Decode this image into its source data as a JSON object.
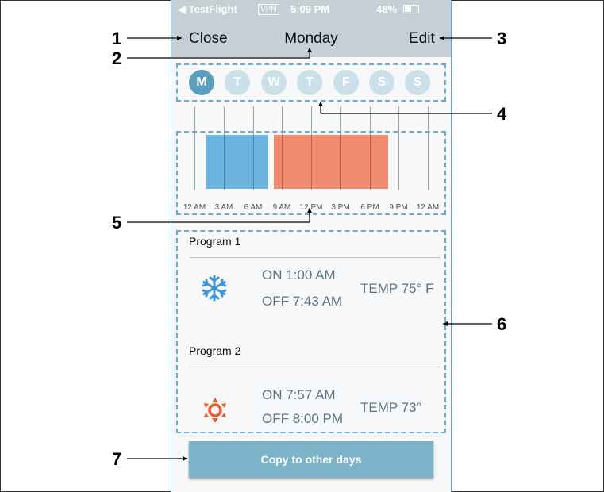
{
  "status_bar": {
    "back_app": "◀ TestFlight",
    "vpn": "VPN",
    "time": "5:09 PM",
    "battery": "48%"
  },
  "header": {
    "close_label": "Close",
    "title": "Monday",
    "edit_label": "Edit"
  },
  "days": [
    {
      "label": "M",
      "active": true
    },
    {
      "label": "T",
      "active": false
    },
    {
      "label": "W",
      "active": false
    },
    {
      "label": "T",
      "active": false
    },
    {
      "label": "F",
      "active": false
    },
    {
      "label": "S",
      "active": false
    },
    {
      "label": "S",
      "active": false
    }
  ],
  "timeline": {
    "ticks": [
      "12 AM",
      "3 AM",
      "6 AM",
      "9 AM",
      "12 PM",
      "3 PM",
      "6 PM",
      "9 PM",
      "12 AM"
    ],
    "cool_color": "#6cb4e0",
    "heat_color": "#f08a6f"
  },
  "programs": [
    {
      "title": "Program 1",
      "mode_icon": "snowflake-icon",
      "on": "ON 1:00 AM",
      "off": "OFF 7:43 AM",
      "temp": "TEMP 75° F"
    },
    {
      "title": "Program 2",
      "mode_icon": "sun-icon",
      "on": "ON 7:57 AM",
      "off": "OFF 8:00 PM",
      "temp": "TEMP 73°"
    }
  ],
  "copy_button": "Copy to other days",
  "callouts": [
    "1",
    "2",
    "3",
    "4",
    "5",
    "6",
    "7"
  ]
}
